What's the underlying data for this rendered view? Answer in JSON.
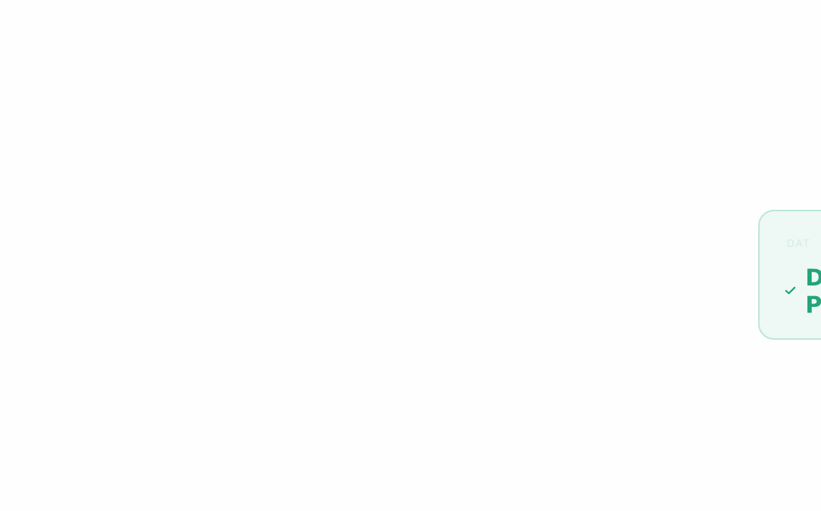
{
  "status_card": {
    "eyebrow": "DAT",
    "title": "D\nP",
    "icon": "check-icon",
    "accent_color": "#22a57a",
    "border_color": "#b9e6d4",
    "background_color": "#eef8f4"
  }
}
